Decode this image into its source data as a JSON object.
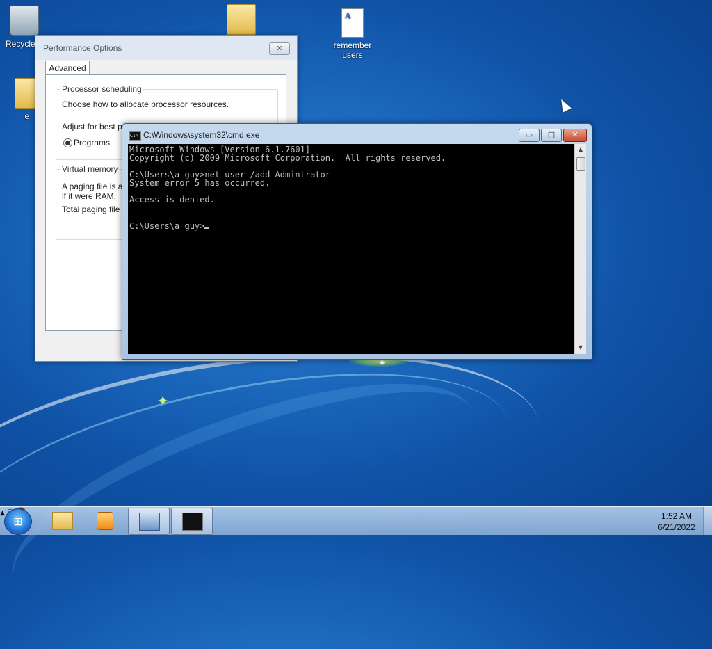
{
  "desktop": {
    "icons": [
      {
        "label": "Recycle"
      },
      {
        "label": ""
      },
      {
        "label": "e"
      },
      {
        "label": "remember users"
      }
    ]
  },
  "perf_window": {
    "title": "Performance Options",
    "close_glyph": "✕",
    "tab_label": "Advanced",
    "processor": {
      "legend": "Processor scheduling",
      "description": "Choose how to allocate processor resources.",
      "adjust_label": "Adjust for best pe",
      "programs_label": "Programs"
    },
    "virtual_memory": {
      "legend": "Virtual memory",
      "line1": "A paging file is an",
      "line2": "if it were RAM.",
      "total_label": "Total paging file si"
    }
  },
  "cmd_window": {
    "title": "C:\\Windows\\system32\\cmd.exe",
    "icon_text": "C:\\",
    "min_glyph": "▭",
    "max_glyph": "□",
    "close_glyph": "✕",
    "lines": [
      "Microsoft Windows [Version 6.1.7601]",
      "Copyright (c) 2009 Microsoft Corporation.  All rights reserved.",
      "",
      "C:\\Users\\a guy>net user /add Admintrator",
      "System error 5 has occurred.",
      "",
      "Access is denied.",
      "",
      ""
    ],
    "prompt": "C:\\Users\\a guy>"
  },
  "taskbar": {
    "start_glyph": "⊞",
    "tray_up_glyph": "▲",
    "network_glyph": "⧉",
    "volume_glyph": "🔇",
    "clock_time": "1:52 AM",
    "clock_date": "6/21/2022"
  }
}
